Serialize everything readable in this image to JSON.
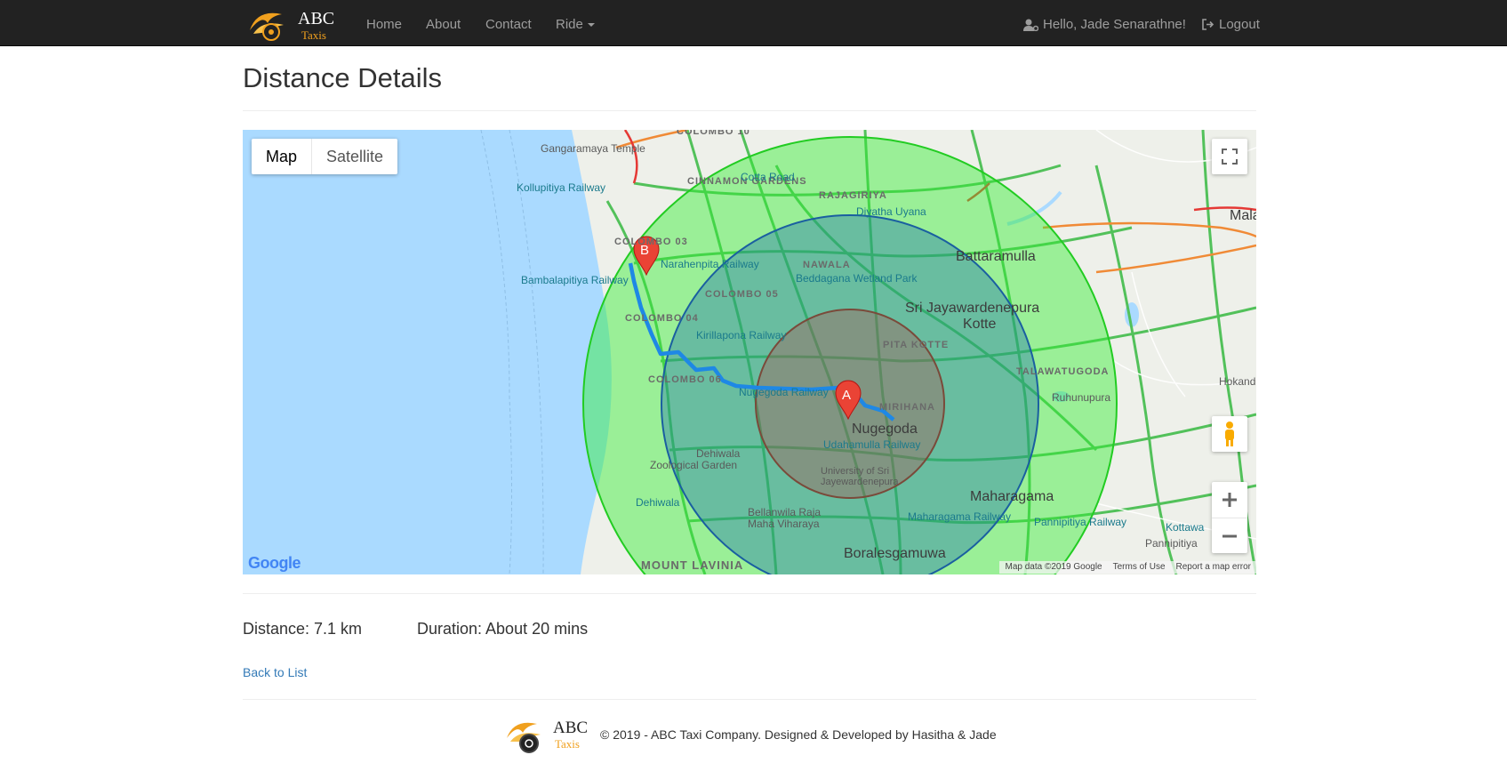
{
  "nav": {
    "brand_main": "ABC",
    "brand_sub": "Taxis",
    "links": [
      "Home",
      "About",
      "Contact",
      "Ride"
    ],
    "greeting": "Hello, Jade Senarathne!",
    "logout": "Logout"
  },
  "page": {
    "title": "Distance Details"
  },
  "map": {
    "type_map": "Map",
    "type_satellite": "Satellite",
    "marker_a": "A",
    "marker_b": "B",
    "google": "Google",
    "attribution": "Map data ©2019 Google",
    "terms": "Terms of Use",
    "report": "Report a map error",
    "labels": {
      "l1": "Gangaramaya Temple",
      "l2": "Kollupitiya Railway",
      "l3": "CINNAMON GARDENS",
      "l4": "Cotta Road",
      "l5": "RAJAGIRIYA",
      "l6": "Diyatha Uyana",
      "l7": "COLOMBO 03",
      "l8": "Narahenpita Railway",
      "l9": "NAWALA",
      "l10": "Battaramulla",
      "l11": "Bambalapitiya Railway",
      "l12": "Beddagana Wetland Park",
      "l13": "COLOMBO 05",
      "l14": "Sri Jayawardenepura",
      "l15": "Kotte",
      "l16": "COLOMBO 04",
      "l17": "Kirillapona Railway",
      "l18": "PITA KOTTE",
      "l19": "TALAWATUGODA",
      "l20": "COLOMBO 06",
      "l21": "Nugegoda Railway",
      "l22": "Ruhunupura",
      "l23": "MIRIHANA",
      "l24": "Nugegoda",
      "l25": "Udahamulla Railway",
      "l26": "Dehiwala",
      "l27": "Zoological Garden",
      "l28": "University of Sri Jayewardenepura",
      "l29": "Dehiwala",
      "l30": "Maharagama",
      "l31": "Bellanwila Raja Maha Viharaya",
      "l32": "Maharagama Railway",
      "l33": "Pannipitiya Railway",
      "l34": "Kottawa",
      "l35": "Pannipitiya",
      "l36": "MOUNT LAVINIA",
      "l37": "Boralesgamuwa",
      "l38": "Hokand",
      "l39": "Mala",
      "l40": "COLOMBO 10"
    }
  },
  "details": {
    "distance": "Distance: 7.1 km",
    "duration": "Duration: About 20 mins",
    "back": "Back to List"
  },
  "footer": {
    "logo_main": "ABC",
    "logo_sub": "Taxis",
    "text": "© 2019 - ABC Taxi Company. Designed & Developed by Hasitha & Jade"
  },
  "colors": {
    "navbar": "#222222",
    "water": "#aadaff",
    "circle_outer": "#33ee33",
    "circle_mid": "#1a6bb0",
    "circle_inner": "#a05a48",
    "route": "#1e88e5",
    "marker": "#ea4335",
    "link": "#337ab7"
  }
}
